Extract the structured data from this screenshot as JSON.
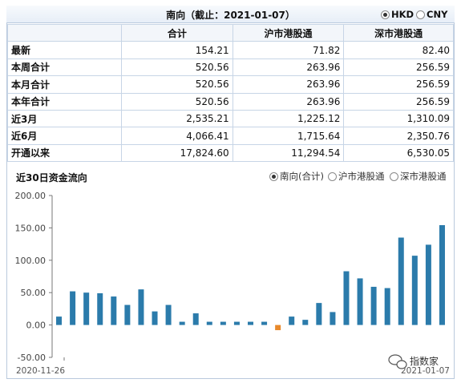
{
  "header": {
    "title": "南向（截止：2021-01-07）",
    "currency_options": [
      "HKD",
      "CNY"
    ],
    "selected_currency": "HKD"
  },
  "table": {
    "columns": [
      "",
      "合计",
      "沪市港股通",
      "深市港股通"
    ],
    "rows": [
      {
        "label": "最新",
        "values": [
          "154.21",
          "71.82",
          "82.40"
        ]
      },
      {
        "label": "本周合计",
        "values": [
          "520.56",
          "263.96",
          "256.59"
        ]
      },
      {
        "label": "本月合计",
        "values": [
          "520.56",
          "263.96",
          "256.59"
        ]
      },
      {
        "label": "本年合计",
        "values": [
          "520.56",
          "263.96",
          "256.59"
        ]
      },
      {
        "label": "近3月",
        "values": [
          "2,535.21",
          "1,225.12",
          "1,310.09"
        ]
      },
      {
        "label": "近6月",
        "values": [
          "4,066.41",
          "1,715.64",
          "2,350.76"
        ]
      },
      {
        "label": "开通以来",
        "values": [
          "17,824.60",
          "11,294.54",
          "6,530.05"
        ]
      }
    ]
  },
  "chart_section": {
    "title": "近30日资金流向",
    "legend_options": [
      "南向(合计)",
      "沪市港股通",
      "深市港股通"
    ],
    "selected": "南向(合计)"
  },
  "watermark": "指数家",
  "colors": {
    "bar_positive": "#2b7bab",
    "bar_negative": "#e8892b",
    "border": "#b9c9dd"
  },
  "chart_data": {
    "type": "bar",
    "title": "近30日资金流向",
    "x_start_label": "2020-11-26",
    "x_end_label": "2021-01-07",
    "values": [
      13,
      52,
      50,
      49,
      44,
      31,
      55,
      21,
      31,
      5,
      18,
      5,
      5,
      5,
      5,
      5,
      -8,
      13,
      8,
      34,
      20,
      83,
      72,
      59,
      57,
      135,
      107,
      124,
      154.21
    ],
    "yticks": [
      "200.00",
      "150.00",
      "100.00",
      "50.00",
      "0.00",
      "-50.00"
    ],
    "ylim": [
      -50,
      200
    ],
    "grid": false
  }
}
